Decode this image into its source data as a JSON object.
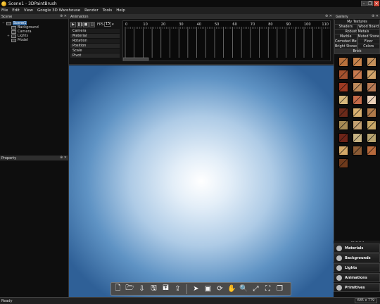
{
  "window": {
    "title": "Scene1 - 3DPaintBrush"
  },
  "menu": [
    "File",
    "Edit",
    "View",
    "Google 3D Warehouse",
    "Render",
    "Tools",
    "Help"
  ],
  "scene_panel": {
    "title": "Scene",
    "tree": [
      {
        "label": "Scene1",
        "level": 0,
        "expander": "−",
        "selected": true
      },
      {
        "label": "Background",
        "level": 1,
        "expander": ""
      },
      {
        "label": "Camera",
        "level": 1,
        "expander": ""
      },
      {
        "label": "Lights",
        "level": 1,
        "expander": "+"
      },
      {
        "label": "Model",
        "level": 1,
        "expander": ""
      }
    ]
  },
  "property_panel": {
    "title": "Property"
  },
  "animation_panel": {
    "title": "Animation",
    "fps_label": "FPS",
    "fps_value": "15",
    "tracks": [
      "Camera",
      "Material",
      "Rotation",
      "Position",
      "Scale",
      "Pivot"
    ],
    "ruler_labels": [
      "0",
      "10",
      "20",
      "30",
      "40",
      "50",
      "60",
      "70",
      "80",
      "90",
      "100",
      "110"
    ]
  },
  "gallery": {
    "title": "Gallery",
    "categories": [
      [
        "My Textures"
      ],
      [
        "Shaders",
        "Wood Board"
      ],
      [
        "Robust Metals"
      ],
      [
        "Marble",
        "Muted Stones"
      ],
      [
        "Corroded Metals",
        "Floor"
      ],
      [
        "Bright Stones",
        "Colors"
      ],
      [
        "Brick"
      ]
    ],
    "thumb_colors": [
      "#b8713c",
      "#c8844c",
      "#c6925c",
      "#a4512e",
      "#c97a4e",
      "#d2a46a",
      "#9c3a22",
      "#c08c5c",
      "#b87a54",
      "#d8b87c",
      "#c46a48",
      "#ead0b8",
      "#6b2a1a",
      "#d8b070",
      "#b07a4a",
      "#a68a54",
      "#c4a070",
      "#c8a868",
      "#6e2418",
      "#c8b484",
      "#b8a470",
      "#d4a868",
      "#8a5a34",
      "#b86a3c",
      "#6e3a1c"
    ]
  },
  "dock": [
    "Materials",
    "Backgrounds",
    "Lights",
    "Animations",
    "Primitives"
  ],
  "status": {
    "left": "Ready",
    "right": "685 x 779"
  },
  "view_toolbar": [
    "new-document",
    "open-document",
    "import-model",
    "save",
    "save-as",
    "export",
    "select-arrow",
    "select-region",
    "rotate-view",
    "pan-hand",
    "zoom",
    "fit-view",
    "fullscreen",
    "duplicate-window"
  ]
}
